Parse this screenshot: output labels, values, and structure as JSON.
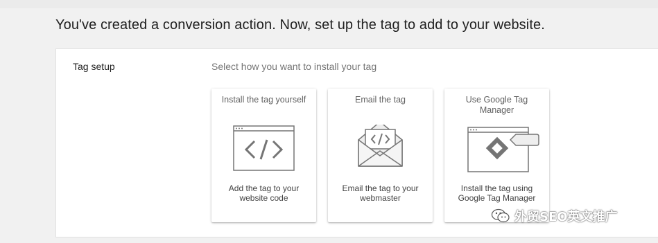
{
  "headline": "You've created a conversion action. Now, set up the tag to add to your website.",
  "tag_setup": {
    "label": "Tag setup",
    "prompt": "Select how you want to install your tag",
    "options": [
      {
        "title": "Install the tag yourself",
        "description": "Add the tag to your website code",
        "icon": "browser-code-icon"
      },
      {
        "title": "Email the tag",
        "description": "Email the tag to your webmaster",
        "icon": "envelope-code-icon"
      },
      {
        "title": "Use Google Tag Manager",
        "description": "Install the tag using Google Tag Manager",
        "icon": "tag-manager-icon"
      }
    ]
  },
  "watermark": {
    "text": "外贸SEO英文推广",
    "icon": "wechat-icon"
  },
  "colors": {
    "illustration_stroke": "#757575",
    "illustration_fill": "#f5f5f5",
    "background": "#f1f1f1"
  }
}
